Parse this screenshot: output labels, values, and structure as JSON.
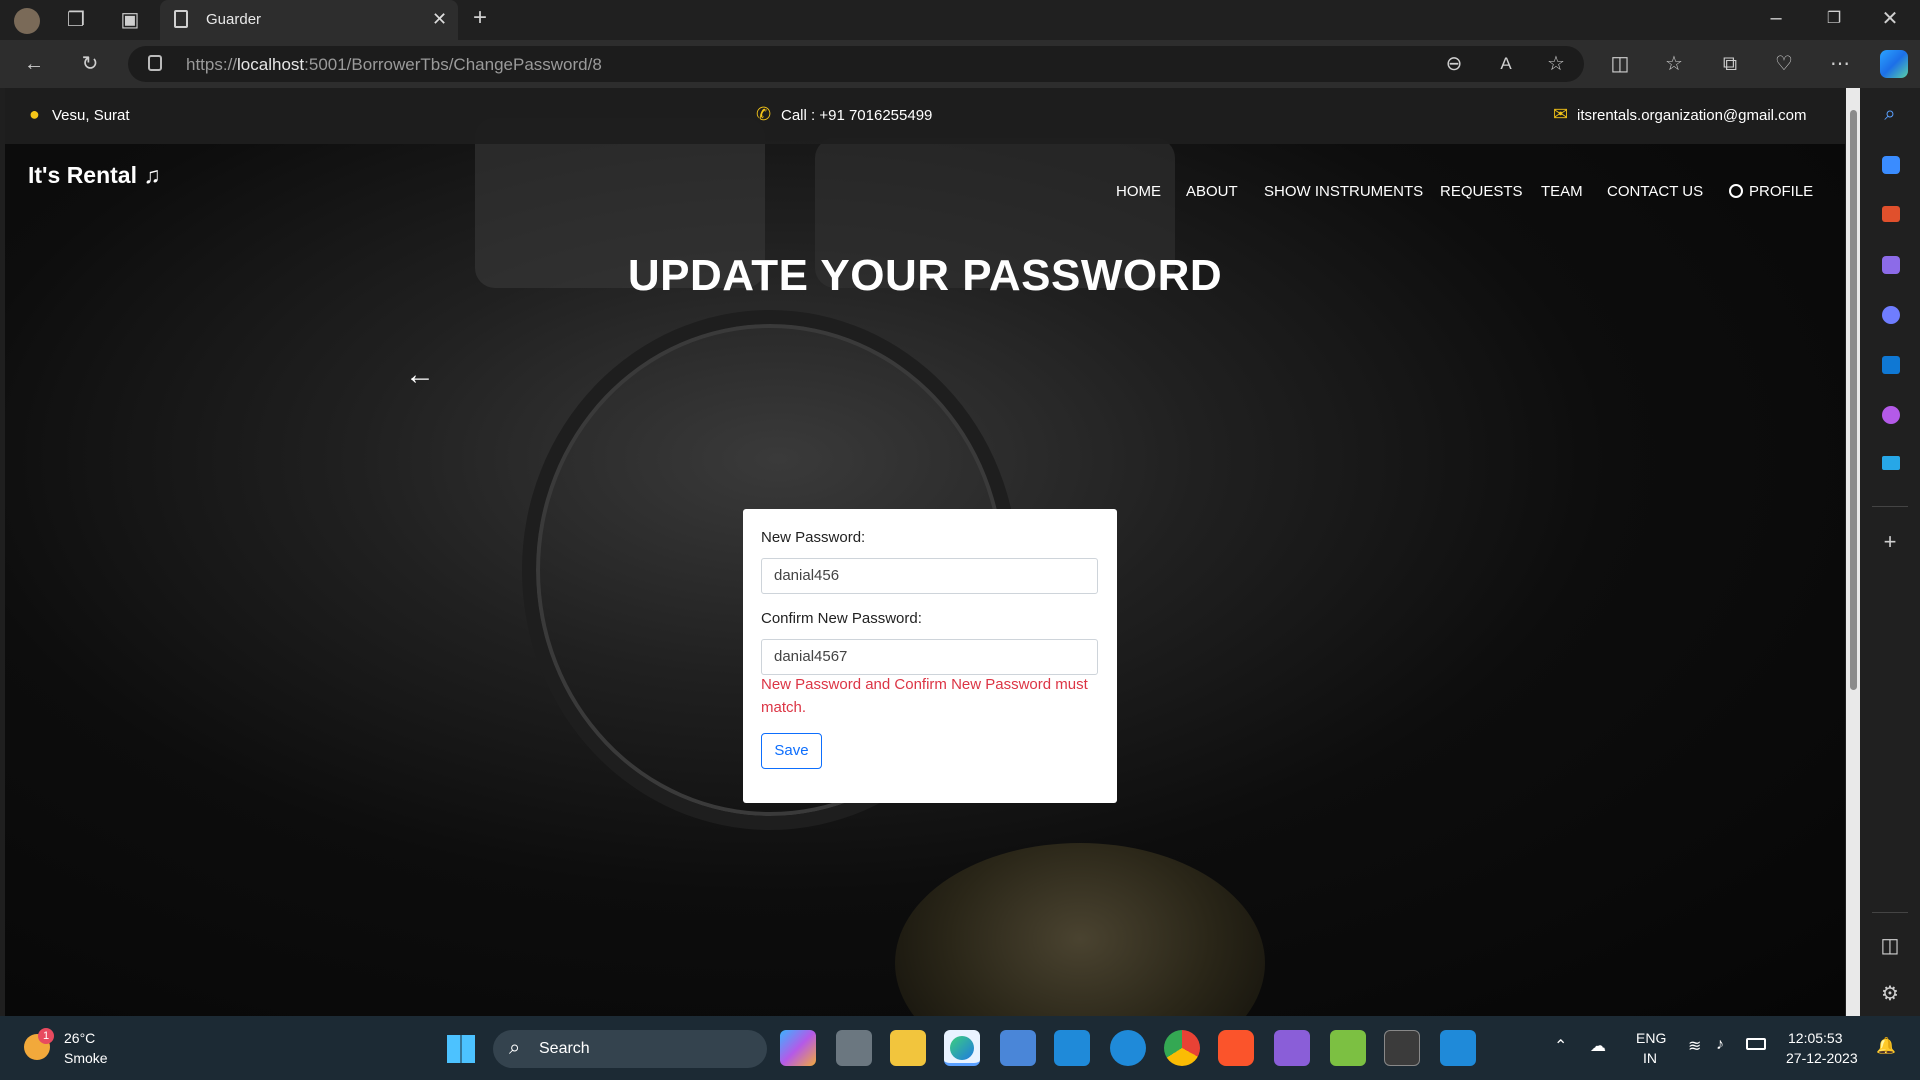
{
  "browser": {
    "tab_title": "Guarder",
    "url_scheme": "https://",
    "url_host": "localhost",
    "url_rest": ":5001/BorrowerTbs/ChangePassword/8"
  },
  "topbar": {
    "location": "Vesu, Surat",
    "call": "Call : +91 7016255499",
    "email": "itsrentals.organization@gmail.com"
  },
  "nav": {
    "brand": "It's Rental",
    "brand_icon": "♫",
    "items": [
      "HOME",
      "ABOUT",
      "SHOW INSTRUMENTS",
      "REQUESTS",
      "TEAM",
      "CONTACT US"
    ],
    "profile": "PROFILE"
  },
  "hero": {
    "title": "UPDATE YOUR PASSWORD",
    "back_arrow": "←"
  },
  "form": {
    "new_password_label": "New Password:",
    "new_password_value": "danial456",
    "confirm_label": "Confirm New Password:",
    "confirm_value": "danial4567",
    "error": "New Password and Confirm New Password must match.",
    "save_label": "Save"
  },
  "taskbar": {
    "weather_temp": "26°C",
    "weather_desc": "Smoke",
    "weather_badge": "1",
    "search": "Search",
    "lang1": "ENG",
    "lang2": "IN",
    "time": "12:05:53",
    "date": "27-12-2023"
  },
  "colors": {
    "error": "#dc3545",
    "primary": "#0d6efd",
    "location_pin": "#f5c518"
  }
}
